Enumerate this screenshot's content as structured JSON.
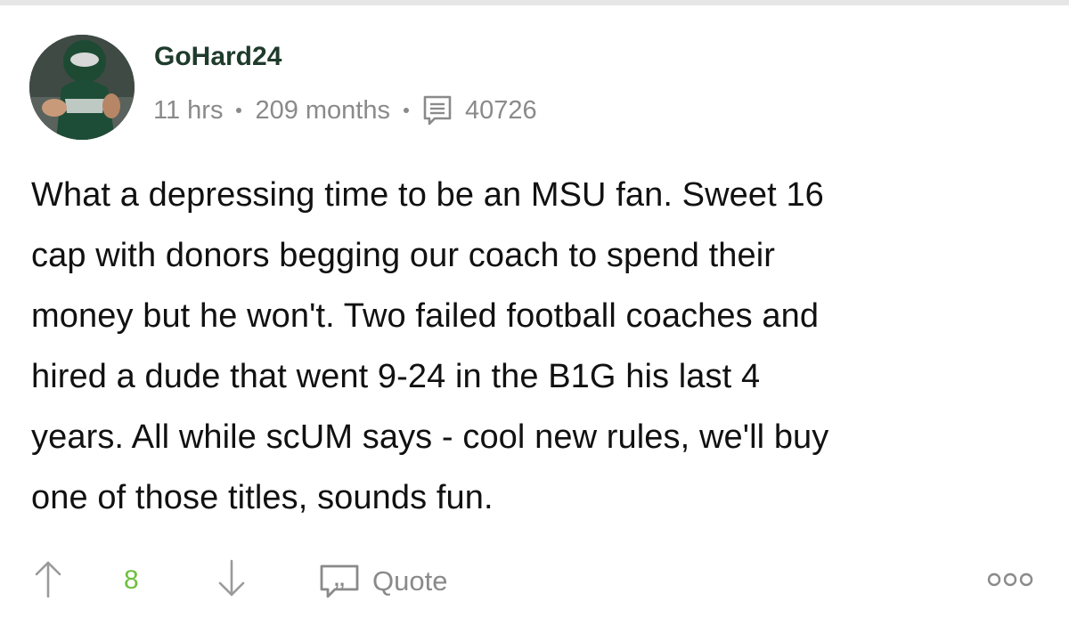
{
  "post": {
    "username": "GoHard24",
    "meta": {
      "time_ago": "11 hrs",
      "membership": "209 months",
      "post_count": "40726"
    },
    "body_lines": [
      "What a depressing time to be an MSU fan. Sweet 16",
      "cap with donors begging our coach to spend their",
      "money but he won't. Two failed football coaches and",
      "hired a dude that went 9-24 in the B1G his last 4",
      "years. All while scUM says - cool new rules, we'll buy",
      "one of those titles, sounds fun."
    ]
  },
  "actions": {
    "score": "8",
    "quote_label": "Quote"
  },
  "icons": {
    "upvote": "arrow-up-icon",
    "downvote": "arrow-down-icon",
    "posts": "posts-icon",
    "quote": "quote-icon",
    "more": "more-options-icon"
  },
  "colors": {
    "username": "#1f3b2c",
    "meta": "#8a8a8a",
    "score": "#6fbf3f",
    "body": "#111111"
  }
}
